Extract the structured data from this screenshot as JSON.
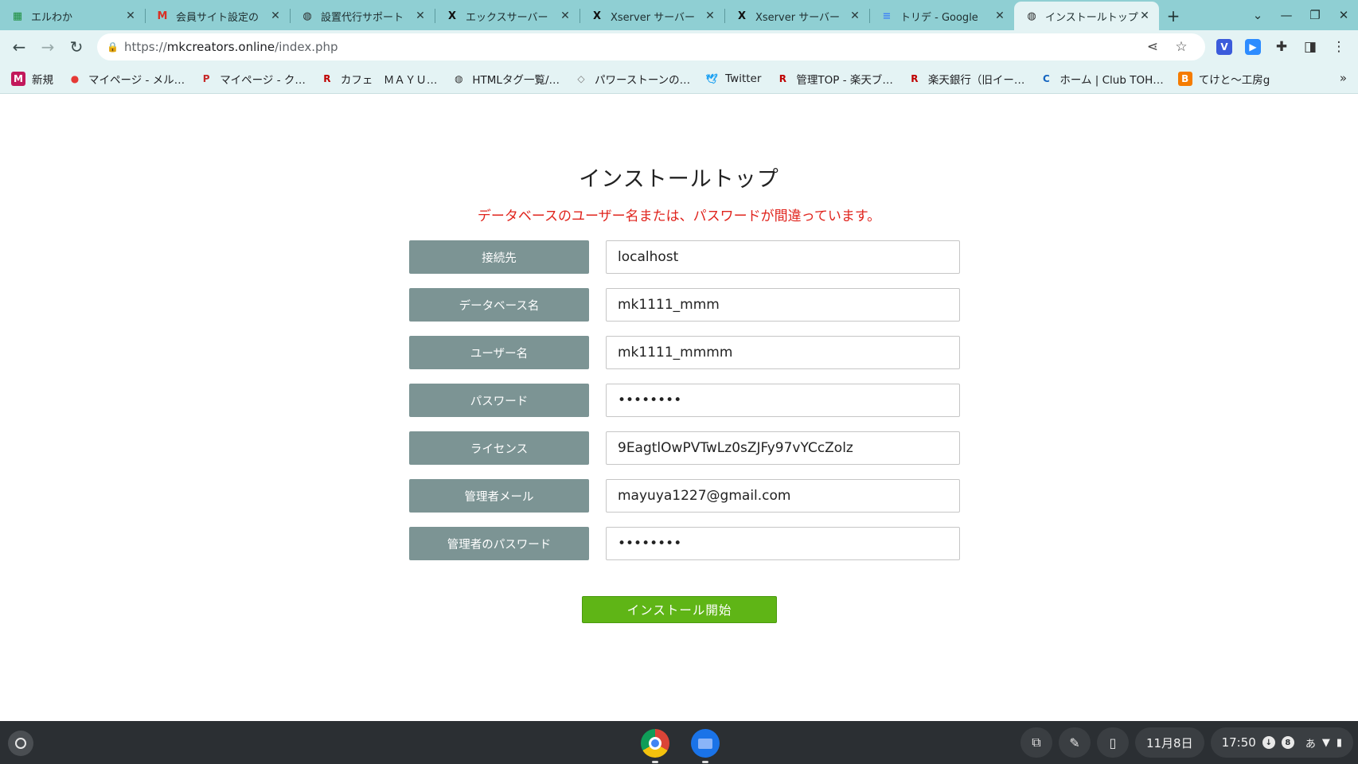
{
  "tabs": [
    {
      "title": "エルわか",
      "icon": "spreadsheet-icon",
      "active": false
    },
    {
      "title": "会員サイト設定の",
      "icon": "gmail-icon",
      "active": false
    },
    {
      "title": "設置代行サポート",
      "icon": "globe-icon",
      "active": false
    },
    {
      "title": "エックスサーバー",
      "icon": "x-icon",
      "active": false
    },
    {
      "title": "Xserver サーバー",
      "icon": "x-icon",
      "active": false
    },
    {
      "title": "Xserver サーバー",
      "icon": "x-icon",
      "active": false
    },
    {
      "title": "トリデ - Google",
      "icon": "docs-icon",
      "active": false
    },
    {
      "title": "インストールトップ",
      "icon": "globe-icon",
      "active": true
    }
  ],
  "toolbar": {
    "url_scheme": "https://",
    "url_host": "mkcreators.online",
    "url_path": "/index.php"
  },
  "bookmarks": [
    {
      "label": "新規",
      "icon": "m-icon",
      "color": "#c2185b"
    },
    {
      "label": "マイページ - メル…",
      "icon": "mercari-icon",
      "color": "#e53935"
    },
    {
      "label": "マイページ - ク…",
      "icon": "rp-icon",
      "color": "#c62828"
    },
    {
      "label": "カフェ　ＭＡＹＵ…",
      "icon": "rakuten-icon",
      "color": "#bf0000"
    },
    {
      "label": "HTMLタグ一覧/…",
      "icon": "globe-icon",
      "color": "#333333"
    },
    {
      "label": "パワーストーンの…",
      "icon": "stone-icon",
      "color": "#777777"
    },
    {
      "label": "Twitter",
      "icon": "twitter-icon",
      "color": "#1da1f2"
    },
    {
      "label": "管理TOP - 楽天ブ…",
      "icon": "rakuten-icon",
      "color": "#bf0000"
    },
    {
      "label": "楽天銀行（旧イー…",
      "icon": "rakuten-icon",
      "color": "#bf0000"
    },
    {
      "label": "ホーム | Club TOH…",
      "icon": "club-icon",
      "color": "#1565c0"
    },
    {
      "label": "てけと〜工房g",
      "icon": "blogger-icon",
      "color": "#f57c00"
    }
  ],
  "page": {
    "heading": "インストールトップ",
    "error": "データベースのユーザー名または、パスワードが間違っています。",
    "fields": [
      {
        "label": "接続先",
        "value": "localhost",
        "type": "text"
      },
      {
        "label": "データベース名",
        "value": "mk1111_mmm",
        "type": "text"
      },
      {
        "label": "ユーザー名",
        "value": "mk1111_mmmm",
        "type": "text"
      },
      {
        "label": "パスワード",
        "value": "••••••••",
        "type": "text"
      },
      {
        "label": "ライセンス",
        "value": "9EagtlOwPVTwLz0sZJFy97vYCcZolz",
        "type": "text"
      },
      {
        "label": "管理者メール",
        "value": "mayuya1227@gmail.com",
        "type": "text"
      },
      {
        "label": "管理者のパスワード",
        "value": "••••••••",
        "type": "text"
      }
    ],
    "submit_label": "インストール開始"
  },
  "shelf": {
    "date": "11月8日",
    "time": "17:50",
    "notification_count": "8",
    "ime": "あ"
  },
  "colors": {
    "label_bg": "#7c9494",
    "submit_bg": "#5fb516",
    "error_text": "#e0241d",
    "tabstrip_bg": "#8fcfd3"
  }
}
